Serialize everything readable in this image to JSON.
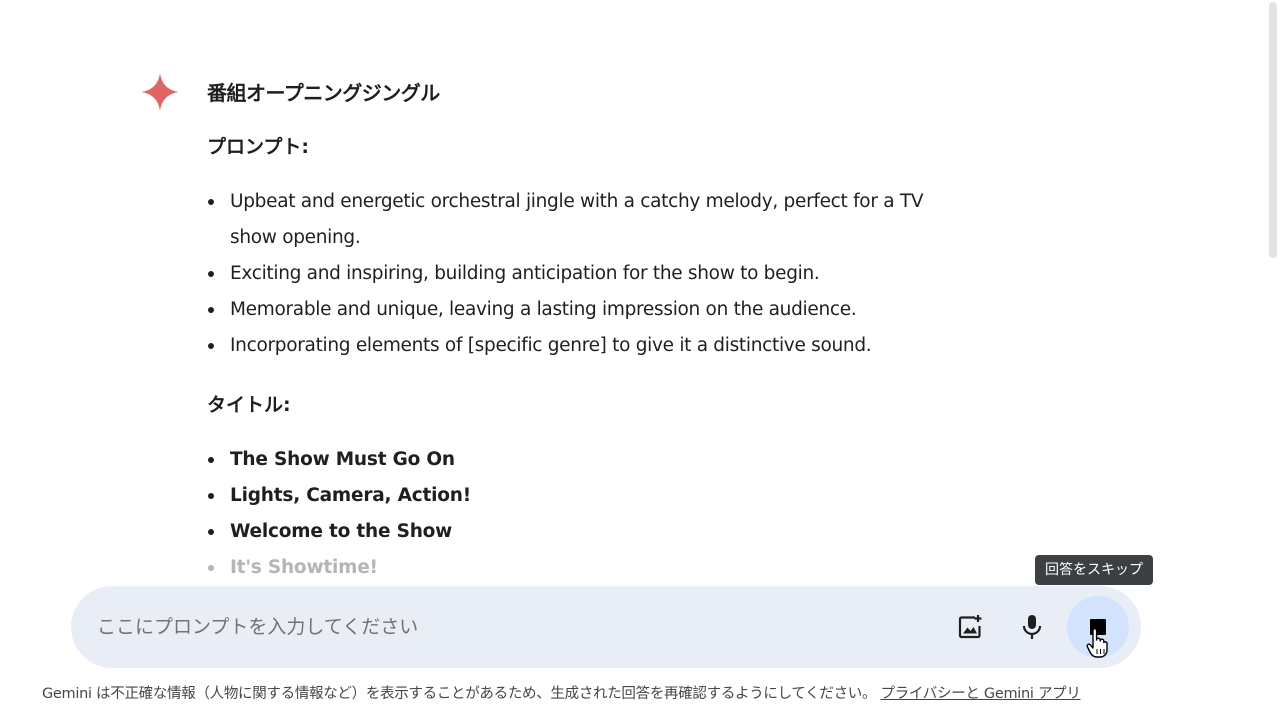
{
  "response": {
    "title": "番組オープニングジングル",
    "prompt_heading": "プロンプト:",
    "prompt_items": [
      "Upbeat and energetic orchestral jingle with a catchy melody, perfect for a TV show opening.",
      "Exciting and inspiring, building anticipation for the show to begin.",
      "Memorable and unique, leaving a lasting impression on the audience.",
      "Incorporating elements of [specific genre] to give it a distinctive sound."
    ],
    "title_heading": "タイトル:",
    "title_items": [
      "The Show Must Go On",
      "Lights, Camera, Action!",
      "Welcome to the Show",
      "It's Showtime!"
    ]
  },
  "tooltip": {
    "text": "回答をスキップ"
  },
  "input": {
    "placeholder": "ここにプロンプトを入力してください",
    "value": ""
  },
  "icons": {
    "sparkle": "gemini-sparkle-icon",
    "image": "add-image-icon",
    "mic": "microphone-icon",
    "stop": "stop-icon"
  },
  "colors": {
    "sparkle": "#e06666",
    "input_bg": "#e9eef6",
    "stop_bg": "#d3e3fd",
    "tooltip_bg": "#3c4043"
  },
  "footer": {
    "text": "Gemini は不正確な情報（人物に関する情報など）を表示することがあるため、生成された回答を再確認するようにしてください。",
    "link": "プライバシーと Gemini アプリ"
  }
}
